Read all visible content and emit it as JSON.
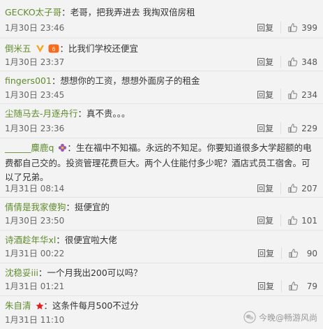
{
  "comments": [
    {
      "user": "GECKO太子哥",
      "separator": "：",
      "text": "老哥，把我弄进去 我掏双倍房租",
      "time": "1月30日 23:46",
      "reply": "回复",
      "likes": "399"
    },
    {
      "user": "倒米五",
      "separator": "：",
      "text": "比我们学校还便宜",
      "time": "1月30日 23:37",
      "reply": "回复",
      "likes": "348"
    },
    {
      "user": "fingers001",
      "separator": "：",
      "text": "想想你的工资，想想外面房子的租金",
      "time": "1月30日 23:45",
      "reply": "回复",
      "likes": "234"
    },
    {
      "user": "尘随马去-月逐舟行",
      "separator": "：",
      "text": "真不贵。。。",
      "time": "1月30日 23:36",
      "reply": "回复",
      "likes": "229"
    },
    {
      "user": "______麋鹿q",
      "separator": "：",
      "text": "生在福中不知福。永远的不知足。你要知道很多大学超额的电费都自己交的。投资管理花费巨大。两个人住能付多少呢？酒店式员工宿舍。可以了兄弟。",
      "time": "1月31日 08:14",
      "reply": "回复",
      "likes": "207"
    },
    {
      "user": "倩倩是我家傻狗",
      "separator": "：",
      "text": "挺便宜的",
      "time": "1月30日 23:50",
      "reply": "回复",
      "likes": "101"
    },
    {
      "user": "诗酒趁年华xl",
      "separator": "：",
      "text": "很便宜啦大佬",
      "time": "1月31日 00:22",
      "reply": "回复",
      "likes": "90"
    },
    {
      "user": "沈稳妥iii",
      "separator": "：",
      "text": "一个月我出200可以吗？",
      "time": "1月31日 01:21",
      "reply": "回复",
      "likes": "79"
    },
    {
      "user": "朱自清",
      "separator": "：",
      "text": "这条件每月500不过分",
      "time": "1月31日 11:10",
      "reply": "",
      "likes": ""
    }
  ],
  "icons": {
    "like": "thumbs-up-icon",
    "vip": "vip-v-icon",
    "flower": "flower-icon",
    "star": "red-star-icon",
    "watermark": "wechat-logo-icon"
  },
  "watermark": {
    "text": "今晚@畅游风尚"
  },
  "colors": {
    "username": "#5f8b2e",
    "background": "#f3f3f3"
  }
}
